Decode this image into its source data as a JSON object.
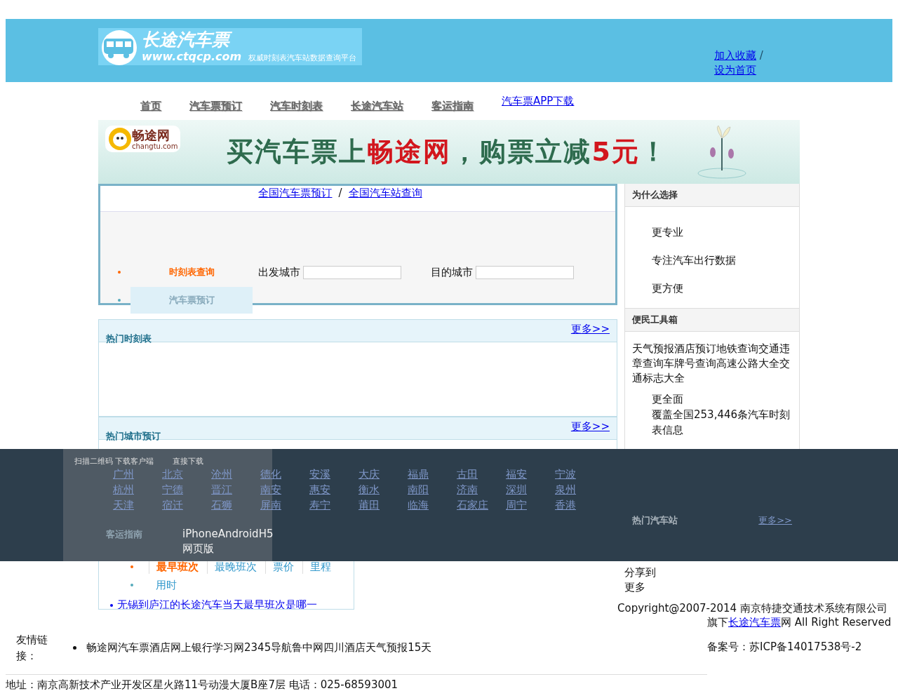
{
  "header": {
    "logo": {
      "title": "长途汽车票",
      "url": "www.ctqcp.com",
      "slogan": "权威时刻表汽车站数据查询平台"
    },
    "links": [
      "加入收藏",
      "设为首页"
    ],
    "separator": "/"
  },
  "nav": [
    {
      "label": "首页",
      "kind": "tab"
    },
    {
      "label": "汽车票预订",
      "kind": "tab"
    },
    {
      "label": "汽车时刻表",
      "kind": "tab"
    },
    {
      "label": "长途汽车站",
      "kind": "tab"
    },
    {
      "label": "客运指南",
      "kind": "tab"
    },
    {
      "label": "汽车票APP下载",
      "kind": "link"
    }
  ],
  "banner": {
    "brand": "畅途网",
    "brand_sub": "changtu.com",
    "headline": [
      {
        "text": "买汽车票上",
        "highlight": false
      },
      {
        "text": "畅途网",
        "highlight": true
      },
      {
        "text": "，购票立减",
        "highlight": false
      },
      {
        "text": "5元",
        "highlight": true
      },
      {
        "text": "！",
        "highlight": false
      }
    ]
  },
  "search": {
    "links": [
      "全国汽车票预订",
      "全国汽车站查询"
    ],
    "separator": "/",
    "tabs": [
      {
        "label": "时刻表查询",
        "selected": true
      },
      {
        "label": "汽车票预订",
        "selected": false
      }
    ],
    "fields": [
      {
        "label": "出发城市"
      },
      {
        "label": "目的城市"
      }
    ]
  },
  "hot_schedule": {
    "title": "热门时刻表",
    "more": "更多>>"
  },
  "hot_cities": {
    "title": "热门城市预订",
    "more": "更多>>",
    "cities": [
      "广州",
      "北京",
      "沧州",
      "德化",
      "安溪",
      "大庆",
      "福鼎",
      "古田",
      "福安",
      "宁波",
      "杭州",
      "宁德",
      "晋江",
      "南安",
      "惠安",
      "衡水",
      "南阳",
      "济南",
      "深圳",
      "泉州",
      "天津",
      "宿迁",
      "石狮",
      "屏南",
      "寿宁",
      "莆田",
      "临海",
      "石家庄",
      "周宁",
      "香港"
    ]
  },
  "guide": {
    "title": "客运指南",
    "tabs": [
      {
        "label": "最早班次",
        "selected": true
      },
      {
        "label": "最晚班次",
        "selected": false
      },
      {
        "label": "票价",
        "selected": false
      },
      {
        "label": "里程",
        "selected": false
      },
      {
        "label": "用时",
        "selected": false
      }
    ],
    "articles": [
      "无锡到庐江的长途汽车当天最早班次是哪一"
    ]
  },
  "sidebar": {
    "why": {
      "title": "为什么选择",
      "items": [
        "更专业",
        "专注汽车出行数据",
        "更方便"
      ]
    },
    "tools": {
      "title": "便民工具箱",
      "links": "天气预报酒店预订地铁查询交通违章查询车牌号查询高速公路大全交通标志大全",
      "items": [
        "更全面",
        "覆盖全国253,446条汽车时刻表信息"
      ]
    },
    "hot_stations": {
      "title": "热门汽车站",
      "more": "更多>>"
    },
    "share": [
      "分享到",
      "更多"
    ]
  },
  "app_bar": {
    "scan": "扫描二维码 下载客户端",
    "direct": "直接下载",
    "platforms": "iPhoneAndroidH5",
    "web": "网页版"
  },
  "footer": {
    "copyright": "Copyright@2007-2014 南京特捷交通技术系统有限公司旗下",
    "copyright_link": "长途汽车票",
    "copyright_end": "网 All Right Reserved",
    "friends_label": "友情链接：",
    "friends": [
      "畅途网汽车票酒店网上银行学习网2345导航鲁中网四川酒店天气预报15天"
    ],
    "icp": "备案号：苏ICP备14017538号-2",
    "address": "地址：南京高新技术产业开发区星火路11号动漫大厦B座7层 电话：025-68593001"
  }
}
